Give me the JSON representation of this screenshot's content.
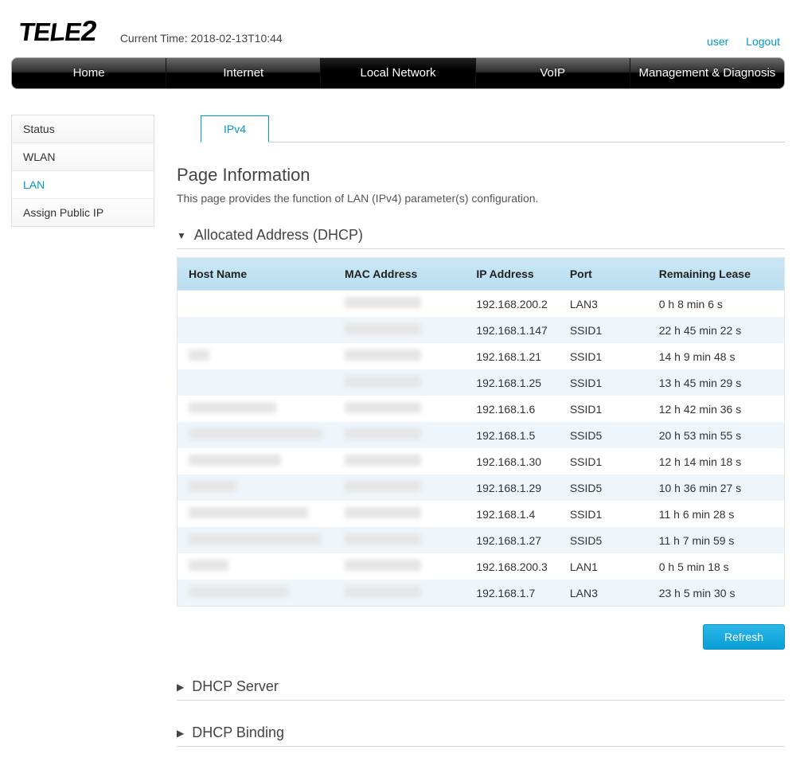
{
  "brand": "TELE2",
  "current_time_label": "Current Time: 2018-02-13T10:44",
  "top_links": {
    "user": "user",
    "logout": "Logout"
  },
  "main_nav": {
    "items": [
      {
        "label": "Home",
        "active": false
      },
      {
        "label": "Internet",
        "active": false
      },
      {
        "label": "Local Network",
        "active": true
      },
      {
        "label": "VoIP",
        "active": false
      },
      {
        "label": "Management & Diagnosis",
        "active": false
      }
    ]
  },
  "sidebar": {
    "items": [
      {
        "label": "Status",
        "active": false
      },
      {
        "label": "WLAN",
        "active": false
      },
      {
        "label": "LAN",
        "active": true
      },
      {
        "label": "Assign Public IP",
        "active": false
      }
    ]
  },
  "tabs": {
    "items": [
      {
        "label": "IPv4",
        "active": true
      }
    ]
  },
  "page": {
    "title": "Page Information",
    "description": "This page provides the function of LAN (IPv4) parameter(s) configuration."
  },
  "sections": {
    "allocated": {
      "title": "Allocated Address (DHCP)",
      "expanded": true
    },
    "dhcp_server": {
      "title": "DHCP Server",
      "expanded": false
    },
    "dhcp_binding": {
      "title": "DHCP Binding",
      "expanded": false
    }
  },
  "table": {
    "columns": [
      "Host Name",
      "MAC Address",
      "IP Address",
      "Port",
      "Remaining Lease"
    ],
    "rows": [
      {
        "host": "",
        "mac": "",
        "ip": "192.168.200.2",
        "port": "LAN3",
        "lease": "0 h 8 min 6 s"
      },
      {
        "host": "",
        "mac": "",
        "ip": "192.168.1.147",
        "port": "SSID1",
        "lease": "22 h 45 min 22 s"
      },
      {
        "host": "",
        "mac": "",
        "ip": "192.168.1.21",
        "port": "SSID1",
        "lease": "14 h 9 min 48 s"
      },
      {
        "host": "",
        "mac": "",
        "ip": "192.168.1.25",
        "port": "SSID1",
        "lease": "13 h 45 min 29 s"
      },
      {
        "host": "",
        "mac": "",
        "ip": "192.168.1.6",
        "port": "SSID1",
        "lease": "12 h 42 min 36 s"
      },
      {
        "host": "",
        "mac": "",
        "ip": "192.168.1.5",
        "port": "SSID5",
        "lease": "20 h 53 min 55 s"
      },
      {
        "host": "",
        "mac": "",
        "ip": "192.168.1.30",
        "port": "SSID1",
        "lease": "12 h 14 min 18 s"
      },
      {
        "host": "",
        "mac": "",
        "ip": "192.168.1.29",
        "port": "SSID5",
        "lease": "10 h 36 min 27 s"
      },
      {
        "host": "",
        "mac": "",
        "ip": "192.168.1.4",
        "port": "SSID1",
        "lease": "11 h 6 min 28 s"
      },
      {
        "host": "",
        "mac": "",
        "ip": "192.168.1.27",
        "port": "SSID5",
        "lease": "11 h 7 min 59 s"
      },
      {
        "host": "",
        "mac": "",
        "ip": "192.168.200.3",
        "port": "LAN1",
        "lease": "0 h 5 min 18 s"
      },
      {
        "host": "",
        "mac": "",
        "ip": "192.168.1.7",
        "port": "LAN3",
        "lease": "23 h 5 min 30 s"
      }
    ]
  },
  "blur_widths": {
    "hosts": [
      0,
      0,
      26,
      0,
      110,
      168,
      116,
      60,
      150,
      166,
      50,
      126
    ],
    "macs": [
      96,
      96,
      96,
      96,
      96,
      96,
      96,
      96,
      96,
      96,
      96,
      96
    ]
  },
  "buttons": {
    "refresh": "Refresh"
  }
}
